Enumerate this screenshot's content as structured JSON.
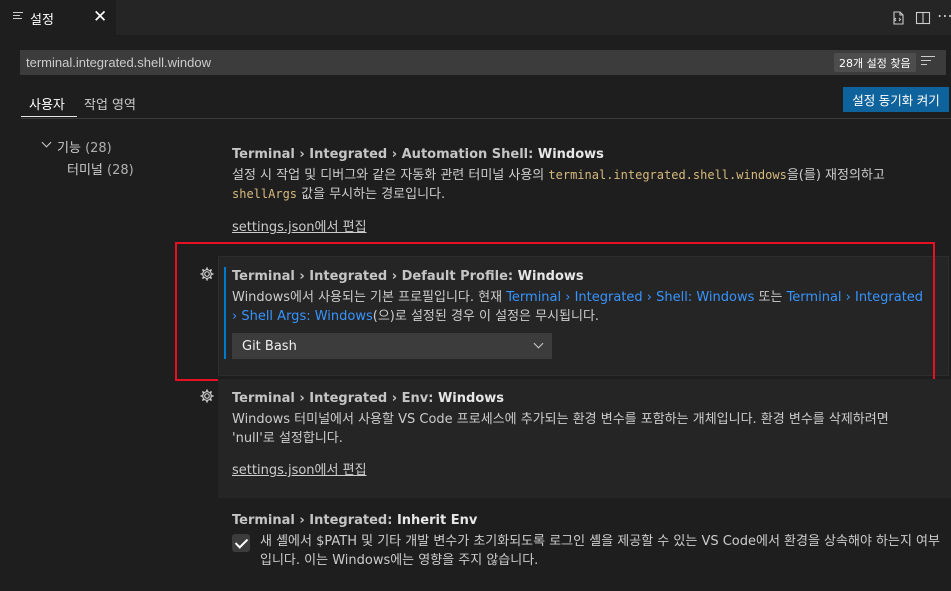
{
  "tab": {
    "label": "설정",
    "close": "✕"
  },
  "search": {
    "value": "terminal.integrated.shell.window",
    "count": "28개 설정 찾음"
  },
  "scope": {
    "user": "사용자",
    "workspace": "작업 영역",
    "sync_button": "설정 동기화 켜기"
  },
  "toc": [
    {
      "label": "기능",
      "count": "(28)"
    },
    {
      "label": "터미널",
      "count": "(28)"
    }
  ],
  "settings": [
    {
      "category": "Terminal › Integrated › Automation Shell: ",
      "name": "Windows",
      "desc_1": "설정 시 작업 및 디버그와 같은 자동화 관련 터미널 사용의 ",
      "desc_code_1": "terminal.integrated.shell.windows",
      "desc_2": "을(를) 재정의하고",
      "desc_code_2": "shellArgs",
      "desc_3": " 값을 무시하는 경로입니다.",
      "edit_link": "settings.json에서 편집"
    },
    {
      "category": "Terminal › Integrated › Default Profile: ",
      "name": "Windows",
      "desc_1": "Windows에서 사용되는 기본 프로필입니다. 현재 ",
      "link_1": "Terminal › Integrated › Shell: Windows",
      "desc_2": " 또는 ",
      "link_2": "Terminal › Integrated › Shell Args: Windows",
      "desc_3": "(으)로 설정된 경우 이 설정은 무시됩니다.",
      "select_value": "Git Bash"
    },
    {
      "category": "Terminal › Integrated › Env: ",
      "name": "Windows",
      "desc": "Windows 터미널에서 사용할 VS Code 프로세스에 추가되는 환경 변수를 포함하는 개체입니다. 환경 변수를 삭제하려면 'null'로 설정합니다.",
      "edit_link": "settings.json에서 편집"
    },
    {
      "category": "Terminal › Integrated: ",
      "name": "Inherit Env",
      "desc": "새 셸에서 $PATH 및 기타 개발 변수가 초기화되도록 로그인 셸을 제공할 수 있는 VS Code에서 환경을 상속해야 하는지 여부입니다. 이는 Windows에는 영향을 주지 않습니다.",
      "checked": true
    }
  ],
  "colors": {
    "accent": "#007acc",
    "button": "#0e639c",
    "highlight_border": "#e81123",
    "link": "#3794ff"
  }
}
